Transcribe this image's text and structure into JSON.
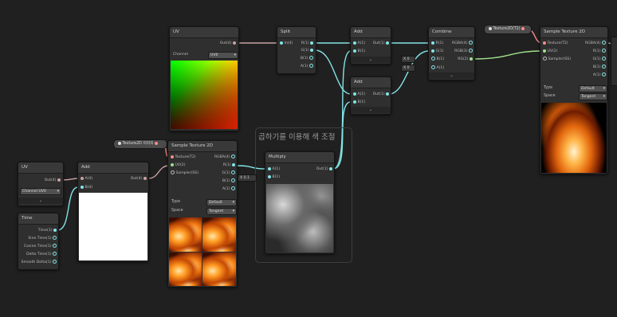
{
  "colors": {
    "bg": "#202020",
    "float_wire": "#84e4e7",
    "vector_wire": "#9fe28b",
    "texture_wire": "#ff8b8b"
  },
  "group": {
    "title": "곱하기를 이용해 색 조절"
  },
  "uv_main": {
    "title": "UV",
    "out": "Out(4)",
    "channel_label": "Channel",
    "channel_value": "UV0"
  },
  "split": {
    "title": "Split",
    "in": "In(4)",
    "outs": [
      "R(1)",
      "G(1)",
      "B(1)",
      "A(1)"
    ]
  },
  "add_top": {
    "title": "Add",
    "a": "A(1)",
    "b": "B(1)",
    "out": "Out(1)"
  },
  "add_mid": {
    "title": "Add",
    "a": "A(1)",
    "b": "B(1)",
    "out": "Out(1)"
  },
  "combine": {
    "title": "Combine",
    "ins": [
      "R(1)",
      "G(1)",
      "B(1)",
      "A(1)"
    ],
    "outs": [
      "RGBA(4)",
      "RGB(3)",
      "RG(2)"
    ],
    "inline_values": [
      "0",
      "0"
    ],
    "inline_label": "X"
  },
  "tex_pill_right": {
    "label": "Texture2D(T2)"
  },
  "sample_right": {
    "title": "Sample Texture 2D",
    "ins": [
      "Texture(T2)",
      "UV(2)",
      "Sampler(SS)"
    ],
    "outs": [
      "RGBA(4)",
      "R(1)",
      "G(1)",
      "B(1)",
      "A(1)"
    ],
    "type_label": "Type",
    "type_value": "Default",
    "space_label": "Space",
    "space_value": "Tangent"
  },
  "tex_pill_left": {
    "label": "Texture2D 이미지"
  },
  "sample_left": {
    "title": "Sample Texture 2D",
    "ins": [
      "Texture(T2)",
      "UV(2)",
      "Sampler(SS)"
    ],
    "outs": [
      "RGBA(4)",
      "R(1)",
      "G(1)",
      "B(1)",
      "A(1)"
    ],
    "type_label": "Type",
    "type_value": "Default",
    "space_label": "Space",
    "space_value": "Tangent"
  },
  "uv_left": {
    "title": "UV",
    "out": "Out(4)",
    "channel_label": "Channel",
    "channel_value": "UV0"
  },
  "add_left": {
    "title": "Add",
    "a": "A(4)",
    "b": "B(4)",
    "out": "Out(4)"
  },
  "time": {
    "title": "Time",
    "outs": [
      "Time(1)",
      "Sine Time(1)",
      "Cosine Time(1)",
      "Delta Time(1)",
      "Smooth Delta(1)"
    ]
  },
  "multiply": {
    "title": "Multiply",
    "a": "A(1)",
    "b": "B(1)",
    "out": "Out(1)",
    "inline_label": "X",
    "inline_value": "0.1"
  }
}
